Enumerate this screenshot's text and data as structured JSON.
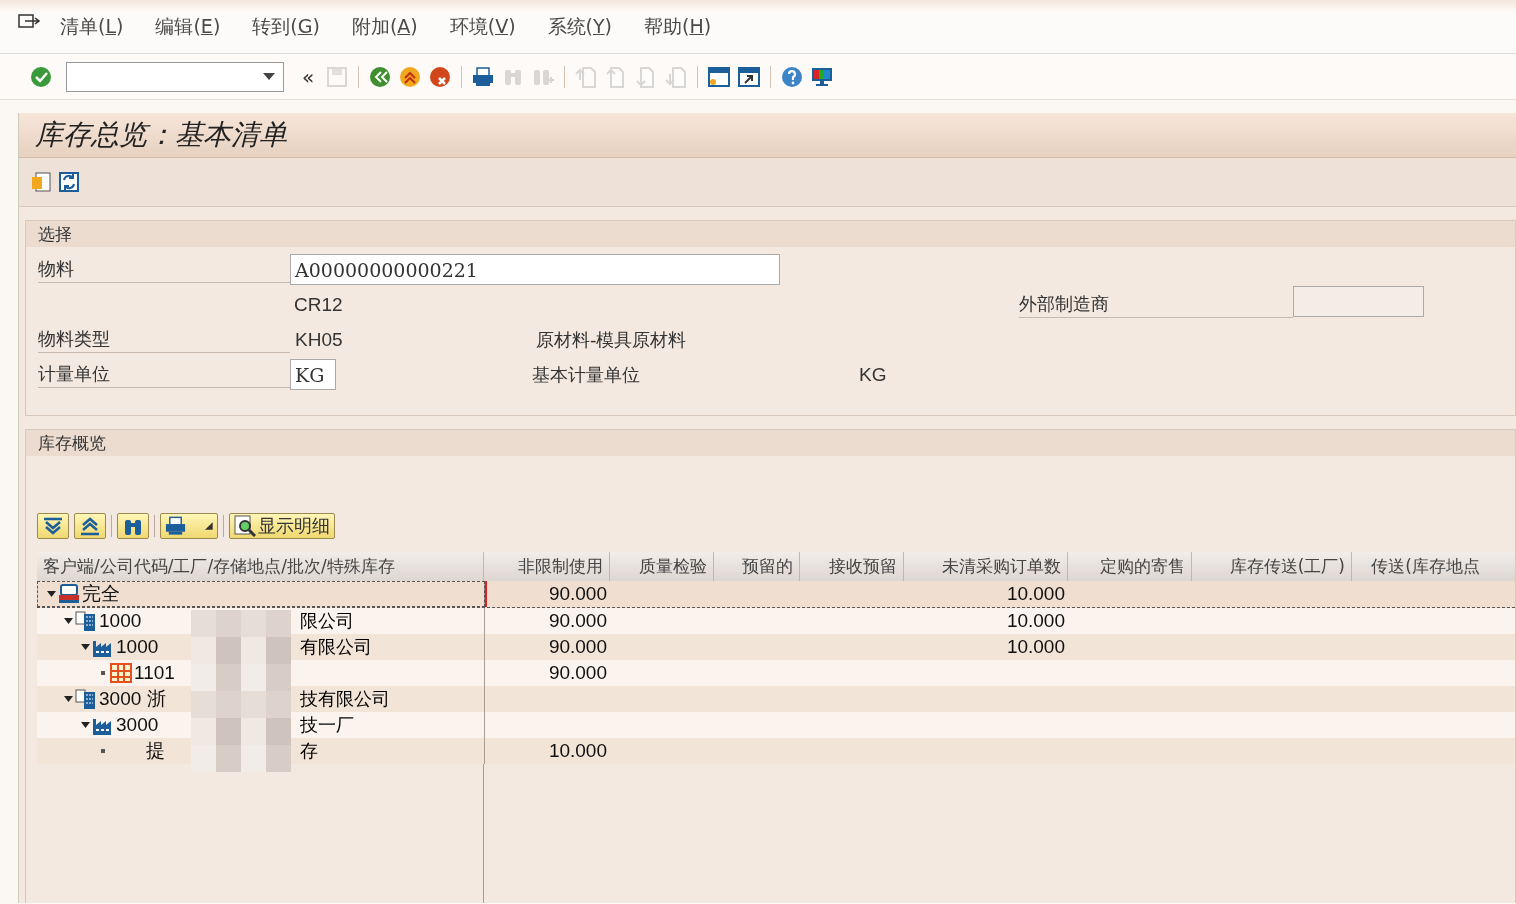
{
  "menu": [
    {
      "label": "清单(L)"
    },
    {
      "label": "编辑(E)"
    },
    {
      "label": "转到(G)"
    },
    {
      "label": "附加(A)"
    },
    {
      "label": "环境(V)"
    },
    {
      "label": "系统(Y)"
    },
    {
      "label": "帮助(H)"
    }
  ],
  "toolbar": {
    "collapse_glyph": "«",
    "buttons": [
      {
        "kind": "check",
        "disabled": false
      },
      {
        "kind": "field"
      },
      {
        "kind": "collapse"
      },
      {
        "kind": "save",
        "disabled": true
      },
      {
        "kind": "sep"
      },
      {
        "kind": "back",
        "disabled": false
      },
      {
        "kind": "exit",
        "disabled": false
      },
      {
        "kind": "cancel",
        "disabled": false
      },
      {
        "kind": "sep"
      },
      {
        "kind": "print",
        "disabled": false
      },
      {
        "kind": "find",
        "disabled": true
      },
      {
        "kind": "find-next",
        "disabled": true
      },
      {
        "kind": "sep"
      },
      {
        "kind": "first",
        "disabled": true
      },
      {
        "kind": "prev",
        "disabled": true
      },
      {
        "kind": "next",
        "disabled": true
      },
      {
        "kind": "last",
        "disabled": true
      },
      {
        "kind": "sep"
      },
      {
        "kind": "new-window",
        "disabled": false
      },
      {
        "kind": "shortcut",
        "disabled": false
      },
      {
        "kind": "sep"
      },
      {
        "kind": "help",
        "disabled": false
      },
      {
        "kind": "monitor",
        "disabled": false
      }
    ]
  },
  "title": "库存总览：基本清单",
  "selection": {
    "title": "选择",
    "material_label": "物料",
    "material_value": "A00000000000221",
    "plant_code": "CR12",
    "manufacturer_label": "外部制造商",
    "type_label": "物料类型",
    "type_value": "KH05",
    "type_desc": "原材料-模具原材料",
    "unit_label": "计量单位",
    "unit_value": "KG",
    "base_unit_label": "基本计量单位",
    "base_unit_value": "KG"
  },
  "overview": {
    "title": "库存概览",
    "details_button": "显示明细",
    "columns": [
      "客户端/公司代码/工厂/存储地点/批次/特殊库存",
      "非限制使用",
      "质量检验",
      "预留的",
      "接收预留",
      "未清采购订单数",
      "定购的寄售",
      "库存传送(工厂)",
      "传送(库存地点"
    ],
    "tree": [
      {
        "kind": "client",
        "label": "完全",
        "selected": true,
        "expanded": true,
        "unrestricted": "90.000",
        "open_po": "10.000",
        "children": [
          {
            "kind": "company",
            "label": "1000",
            "label_end": "限公司",
            "expanded": true,
            "unrestricted": "90.000",
            "open_po": "10.000",
            "children": [
              {
                "kind": "plant",
                "label": "1000",
                "label_end": "有限公司",
                "expanded": true,
                "unrestricted": "90.000",
                "open_po": "10.000",
                "children": [
                  {
                    "kind": "storage",
                    "label": "1101",
                    "unrestricted": "90.000"
                  }
                ]
              }
            ]
          },
          {
            "kind": "company",
            "label": "3000 浙",
            "label_end": "技有限公司",
            "expanded": true,
            "children": [
              {
                "kind": "plant",
                "label": "3000",
                "label_end": "技一厂",
                "expanded": true,
                "children": [
                  {
                    "kind": "special",
                    "label": "提",
                    "label_end": "存",
                    "unrestricted": "10.000"
                  }
                ]
              }
            ]
          }
        ]
      }
    ]
  }
}
